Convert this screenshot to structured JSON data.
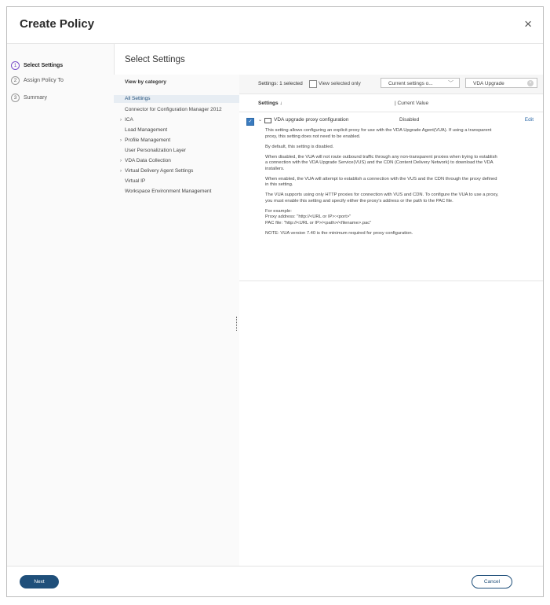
{
  "dialog": {
    "title": "Create Policy",
    "close_symbol": "×"
  },
  "steps": [
    {
      "num": "1",
      "label": "Select Settings"
    },
    {
      "num": "2",
      "label": "Assign Policy To"
    },
    {
      "num": "3",
      "label": "Summary"
    }
  ],
  "section_title": "Select Settings",
  "categories": {
    "heading": "View by category",
    "items": [
      {
        "label": "All Settings",
        "expand": ""
      },
      {
        "label": "Connector for Configuration Manager 2012",
        "expand": ""
      },
      {
        "label": "ICA",
        "expand": "›"
      },
      {
        "label": "Load Management",
        "expand": ""
      },
      {
        "label": "Profile Management",
        "expand": "›"
      },
      {
        "label": "User Personalization Layer",
        "expand": ""
      },
      {
        "label": "VDA Data Collection",
        "expand": "›"
      },
      {
        "label": "Virtual Delivery Agent Settings",
        "expand": "›"
      },
      {
        "label": "Virtual IP",
        "expand": ""
      },
      {
        "label": "Workspace Environment Management",
        "expand": ""
      }
    ]
  },
  "toolbar": {
    "count": "Settings: 1 selected",
    "view_selected": "View selected only",
    "dropdown_value": "Current settings o...",
    "search_value": "VDA Upgrade"
  },
  "columns": {
    "settings": "Settings ↓",
    "current_value": "|  Current Value"
  },
  "setting": {
    "name": "VDA upgrade proxy configuration",
    "value": "Disabled",
    "edit": "Edit",
    "description": [
      "This setting allows configuring an explicit proxy for use with the VDA Upgrade Agent(VUA). If using a transparent proxy, this setting does not need to be enabled.",
      "By default, this setting is disabled.",
      "When disabled, the VUA will not route outbound traffic through any non-transparent proxies when trying to establish a connection with the VDA Upgrade Service(VUS) and the CDN (Content Delivery Network) to download the VDA installers.",
      "When enabled, the VUA will attempt to establish a connection with the VUS and the CDN through the proxy defined in this setting.",
      "The VUA supports using only HTTP proxies for connection with VUS and CDN. To configure the VUA to use a proxy, you must enable this setting and specify either the proxy's address or the path to the PAC file.",
      "For example:",
      "Proxy address: \"http://<URL or IP>:<port>\"",
      "PAC file: \"http://<URL or IP>/<path>/<filename>.pac\"",
      "NOTE: VUA version 7.40 is the minimum required for proxy configuration."
    ]
  },
  "footer": {
    "next": "Next",
    "cancel": "Cancel"
  },
  "colors": {
    "accent": "#1f4f7a",
    "step_active": "#7b4fc9",
    "link": "#2f6ba8"
  }
}
